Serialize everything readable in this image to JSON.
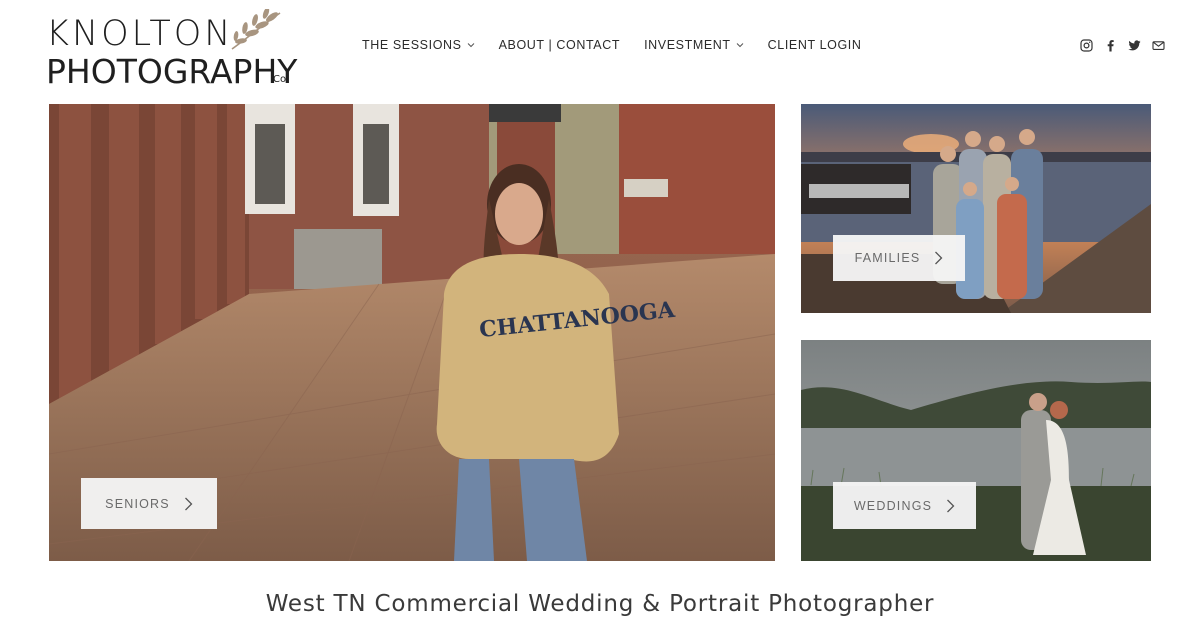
{
  "logo": {
    "line1": "KNOLTON",
    "line2": "PHOTOGRAPHY",
    "suffix": "Co.",
    "leaf_color": "#a89580"
  },
  "nav": {
    "items": [
      {
        "label": "THE SESSIONS",
        "has_dropdown": true
      },
      {
        "label": "ABOUT | CONTACT",
        "has_dropdown": false
      },
      {
        "label": "INVESTMENT",
        "has_dropdown": true
      },
      {
        "label": "CLIENT LOGIN",
        "has_dropdown": false
      }
    ]
  },
  "social": {
    "icons": [
      "instagram-icon",
      "facebook-icon",
      "twitter-icon",
      "email-icon"
    ]
  },
  "tiles": {
    "seniors": {
      "label": "SENIORS"
    },
    "families": {
      "label": "FAMILIES"
    },
    "weddings": {
      "label": "WEDDINGS"
    }
  },
  "tagline": "West TN Commercial Wedding & Portrait Photographer",
  "colors": {
    "button_bg": "#f5f5f5",
    "button_text": "#6a6a6a",
    "text_dark": "#2b2b2b"
  }
}
